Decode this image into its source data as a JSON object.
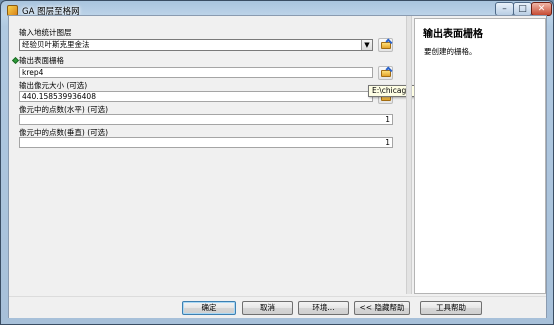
{
  "window": {
    "title": "GA 图层至格网",
    "minimize_glyph": "–",
    "maximize_glyph": "□",
    "close_glyph": "✕"
  },
  "form": {
    "input_layer_label": "输入地统计图层",
    "input_layer_value": "经验贝叶斯克里金法",
    "output_raster_label": "输出表面栅格",
    "output_raster_value": "krep4",
    "cell_size_label": "输出像元大小 (可选)",
    "cell_size_value": "440.158539936408",
    "points_x_label": "像元中的点数(水平) (可选)",
    "points_x_value": "1",
    "points_y_label": "像元中的点数(垂直) (可选)",
    "points_y_value": "1",
    "tooltip": "E:\\chicago"
  },
  "help": {
    "title": "输出表面栅格",
    "text": "要创建的栅格。"
  },
  "buttons": {
    "ok": "确定",
    "cancel": "取消",
    "env": "环境...",
    "hide_help": "<< 隐藏帮助",
    "tool_help": "工具帮助"
  },
  "colors": {
    "required_marker": "#2e9c3a",
    "title_gradient_top": "#a9c4de"
  },
  "icons": {
    "window": "arcgis-tool-icon",
    "browse": "open-folder-icon",
    "required": "green-diamond-icon"
  }
}
